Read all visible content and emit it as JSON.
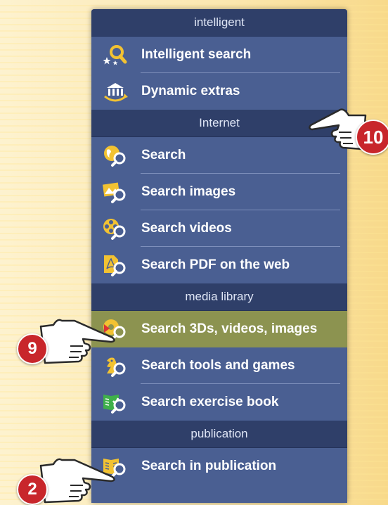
{
  "menu": {
    "sections": [
      {
        "header": "intelligent",
        "items": [
          {
            "label": "Intelligent search",
            "icon": "magnifier-stars-icon"
          },
          {
            "label": "Dynamic extras",
            "icon": "dynamic-extras-icon"
          }
        ]
      },
      {
        "header": "Internet",
        "items": [
          {
            "label": "Search",
            "icon": "globe-search-icon"
          },
          {
            "label": "Search images",
            "icon": "image-search-icon"
          },
          {
            "label": "Search videos",
            "icon": "film-reel-search-icon"
          },
          {
            "label": "Search PDF on the web",
            "icon": "pdf-search-icon"
          }
        ]
      },
      {
        "header": "media library",
        "items": [
          {
            "label": "Search 3Ds, videos, images",
            "icon": "media-search-icon",
            "active": true
          },
          {
            "label": "Search tools and games",
            "icon": "chess-knight-search-icon"
          },
          {
            "label": "Search exercise book",
            "icon": "exercise-book-search-icon"
          }
        ]
      },
      {
        "header": "publication",
        "items": [
          {
            "label": "Search in publication",
            "icon": "publication-search-icon"
          }
        ]
      }
    ]
  },
  "callouts": [
    {
      "number": "10"
    },
    {
      "number": "9"
    },
    {
      "number": "2"
    }
  ],
  "colors": {
    "menu_bg": "#4a5f92",
    "header_bg": "#2f3f69",
    "active_bg": "#8c9350",
    "badge": "#c8262b"
  }
}
